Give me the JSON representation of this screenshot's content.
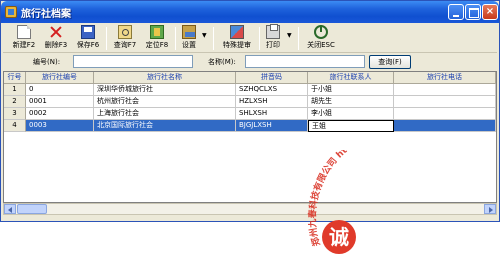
{
  "window": {
    "title": "旅行社档案"
  },
  "toolbar": {
    "new_label": "新建F2",
    "delete_label": "删除F3",
    "save_label": "保存F6",
    "query_label": "查询F7",
    "locate_label": "定位F8",
    "settings_label": "设置",
    "special_label": "特殊提审",
    "print_label": "打印",
    "close_label": "关闭ESC"
  },
  "search": {
    "code_label": "编号(N):",
    "code_value": "",
    "name_label": "名称(M):",
    "name_value": "",
    "query_button": "查询(F)"
  },
  "grid": {
    "columns": [
      "行号",
      "旅行社编号",
      "旅行社名称",
      "拼音码",
      "旅行社联系人",
      "旅行社电话"
    ],
    "rows": [
      {
        "num": "1",
        "code": "0",
        "name": "深圳华侨城旅行社",
        "pinyin": "SZHQCLXS",
        "contact": "于小姐",
        "phone": ""
      },
      {
        "num": "2",
        "code": "0001",
        "name": "杭州旅行社会",
        "pinyin": "HZLXSH",
        "contact": "胡先生",
        "phone": ""
      },
      {
        "num": "3",
        "code": "0002",
        "name": "上海旅行社会",
        "pinyin": "SHLXSH",
        "contact": "李小姐",
        "phone": ""
      },
      {
        "num": "4",
        "code": "0003",
        "name": "北京国际旅行社会",
        "pinyin": "BJGJLXSH",
        "contact": "王姐",
        "phone": ""
      }
    ],
    "selected_row": 4
  },
  "watermark": {
    "seal_char": "诚",
    "arc_text": "郑州九春科技有限公司 http://www.9mka.com"
  },
  "colors": {
    "titlebar": "#1f63dc",
    "selection": "#316ac5",
    "header_text": "#1a3fb0",
    "seal": "#e03a2a"
  }
}
